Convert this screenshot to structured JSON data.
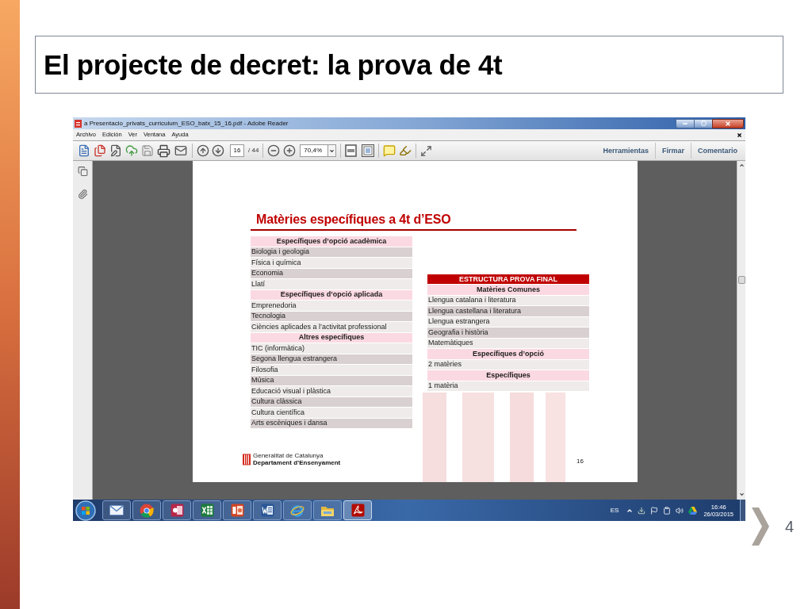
{
  "slide": {
    "title": "El projecte de decret: la prova de 4t",
    "page_number": "4"
  },
  "window": {
    "title": "a Presentacio_privats_curriculum_ESO_batx_15_16.pdf - Adobe Reader"
  },
  "menu": [
    "Archivo",
    "Edición",
    "Ver",
    "Ventana",
    "Ayuda"
  ],
  "toolbar": {
    "page": "16",
    "page_count": "/ 44",
    "zoom": "70,4%",
    "panes": [
      "Herramientas",
      "Firmar",
      "Comentario"
    ]
  },
  "document_page": {
    "heading": "Matèries específiques a 4t d’ESO",
    "left_table": [
      {
        "kind": "header",
        "text": "Específiques d’opció acadèmica"
      },
      {
        "kind": "row",
        "text": "Biologia i geologia"
      },
      {
        "kind": "row",
        "text": "Física i química"
      },
      {
        "kind": "row",
        "text": "Economia"
      },
      {
        "kind": "row",
        "text": "Llatí"
      },
      {
        "kind": "header",
        "text": "Específiques d’opció aplicada"
      },
      {
        "kind": "row",
        "text": "Emprenedoria"
      },
      {
        "kind": "row",
        "text": "Tecnologia"
      },
      {
        "kind": "row",
        "text": "Ciències aplicades a l’activitat professional"
      },
      {
        "kind": "header",
        "text": "Altres específiques"
      },
      {
        "kind": "row",
        "text": "TIC (informàtica)"
      },
      {
        "kind": "row",
        "text": "Segona llengua estrangera"
      },
      {
        "kind": "row",
        "text": "Filosofia"
      },
      {
        "kind": "row",
        "text": "Música"
      },
      {
        "kind": "row",
        "text": "Educació visual i plàstica"
      },
      {
        "kind": "row",
        "text": "Cultura clàssica"
      },
      {
        "kind": "row",
        "text": "Cultura científica"
      },
      {
        "kind": "row",
        "text": "Arts escèniques i dansa"
      }
    ],
    "right_table": [
      {
        "kind": "title",
        "text": "ESTRUCTURA PROVA FINAL"
      },
      {
        "kind": "header",
        "text": "Matèries Comunes"
      },
      {
        "kind": "row",
        "text": "Llengua catalana i literatura"
      },
      {
        "kind": "row",
        "text": "Llengua castellana i literatura"
      },
      {
        "kind": "row",
        "text": "Llengua estrangera"
      },
      {
        "kind": "row",
        "text": "Geografia i història"
      },
      {
        "kind": "row",
        "text": "Matemàtiques"
      },
      {
        "kind": "header",
        "text": "Específiques d’opció"
      },
      {
        "kind": "row",
        "text": "2 matèries"
      },
      {
        "kind": "header",
        "text": "Específiques"
      },
      {
        "kind": "row",
        "text": "1 matèria"
      }
    ],
    "footer": {
      "organization": "Generalitat de Catalunya",
      "department": "Departament d’Ensenyament",
      "page_number": "16"
    }
  },
  "taskbar": {
    "language": "ES",
    "time": "16:46",
    "date": "26/03/2015"
  }
}
